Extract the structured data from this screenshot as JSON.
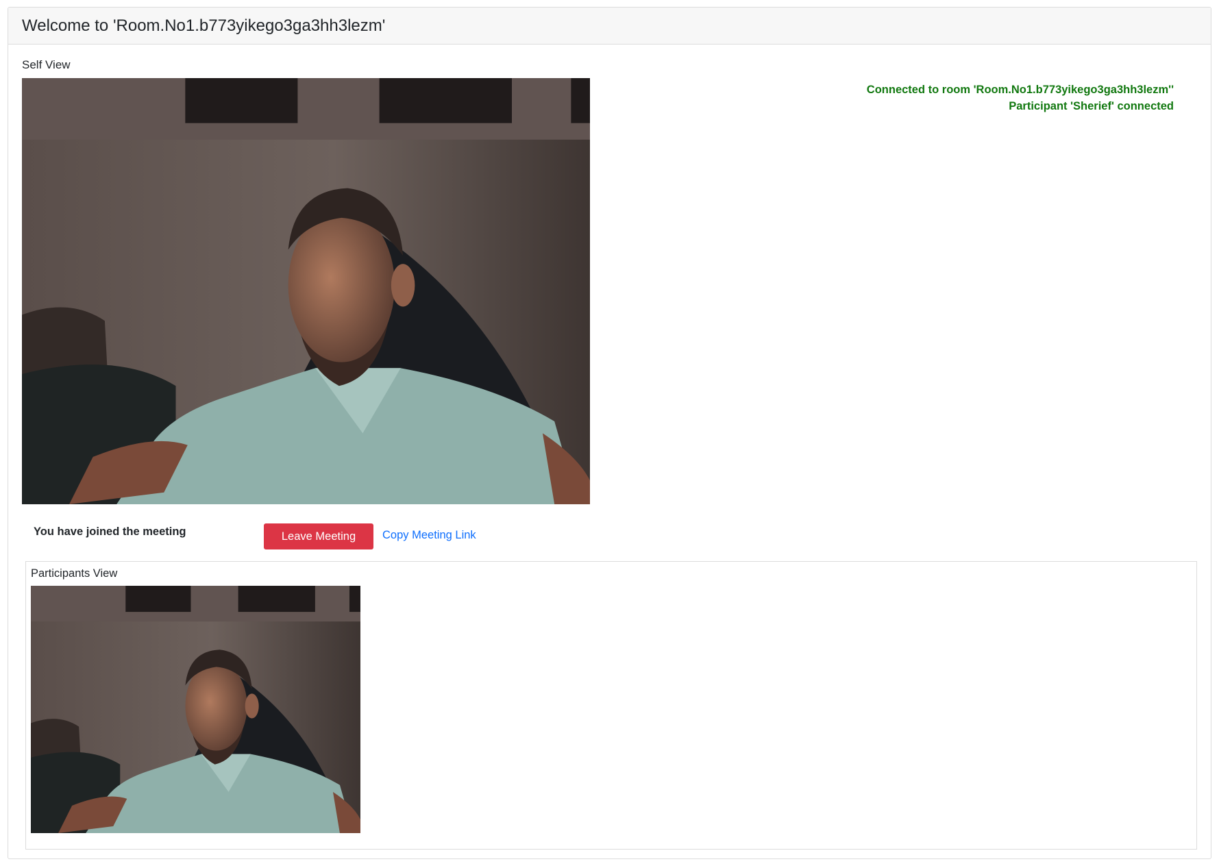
{
  "window": {
    "title": "Welcome to 'Room.No1.b773yikego3ga3hh3lezm'"
  },
  "self_view": {
    "label": "Self View"
  },
  "status_log": [
    "Connected to room 'Room.No1.b773yikego3ga3hh3lezm''",
    "Participant 'Sherief' connected"
  ],
  "controls": {
    "joined_text": "You have joined the meeting",
    "leave_label": "Leave Meeting",
    "copy_link_label": "Copy Meeting Link"
  },
  "participants_view": {
    "label": "Participants View"
  },
  "colors": {
    "leave_button": "#dc3545",
    "link": "#0d6efd",
    "status_text": "#11780f",
    "header_background": "#f7f7f7"
  }
}
